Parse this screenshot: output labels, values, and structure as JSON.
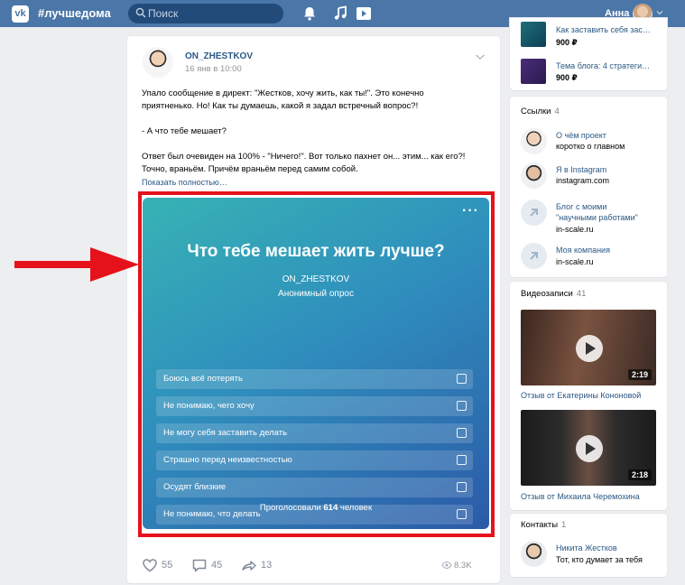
{
  "header": {
    "logo_icon": "vk-logo",
    "site_name": "#лучшедома",
    "search_placeholder": "Поиск",
    "icons": [
      "bell-icon",
      "music-icon",
      "play-icon"
    ],
    "user_name": "Анна"
  },
  "post": {
    "author": "ON_ZHESTKOV",
    "date": "16 янв в 10:00",
    "text_lines": [
      "Упало сообщение в директ: \"Жестков, хочу жить, как ты!\". Это конечно",
      "приятненько. Но! Как ты думаешь, какой я задал встречный вопрос?!",
      "- А что тебе мешает?",
      "Ответ был очевиден на 100% - \"Ничего!\". Вот только пахнет он... этим... как его?!",
      "Точно, враньём. Причём враньём перед самим собой."
    ],
    "show_more": "Показать полностью…",
    "poll": {
      "title": "Что тебе мешает жить лучше?",
      "author": "ON_ZHESTKOV",
      "type": "Анонимный опрос",
      "options": [
        "Боюсь всё потерять",
        "Не понимаю, чего хочу",
        "Не могу себя заставить делать",
        "Страшно перед неизвестностью",
        "Осудят близкие",
        "Не понимаю, что делать"
      ],
      "votes_prefix": "Проголосовали",
      "votes_count": "614",
      "votes_suffix": "человек"
    },
    "likes": "55",
    "comments": "45",
    "shares": "13",
    "views": "8.3K"
  },
  "sidebar": {
    "products": [
      {
        "title": "Как заставить себя зас…",
        "price": "900 ₽"
      },
      {
        "title": "Тема блога: 4 стратеги…",
        "price": "900 ₽"
      }
    ],
    "links": {
      "heading": "Ссылки",
      "count": "4",
      "items": [
        {
          "title": "О чём проект",
          "sub": "коротко о главном"
        },
        {
          "title": "Я в Instagram",
          "sub": "instagram.com"
        },
        {
          "title_lines": [
            "Блог с моими",
            "\"научными работами\""
          ],
          "sub": "in-scale.ru"
        },
        {
          "title": "Моя компания",
          "sub": "in-scale.ru"
        }
      ]
    },
    "videos": {
      "heading": "Видеозаписи",
      "count": "41",
      "items": [
        {
          "duration": "2:19",
          "caption": "Отзыв от Екатерины Кононовой"
        },
        {
          "duration": "2:18",
          "caption": "Отзыв от Михаила Черемохина"
        }
      ]
    },
    "contacts": {
      "heading": "Контакты",
      "count": "1",
      "items": [
        {
          "name": "Никита Жестков",
          "sub": "Тот, кто думает за тебя"
        }
      ]
    }
  },
  "colors": {
    "header": "#4a76a8",
    "link": "#2a5885",
    "highlight": "#e5121b",
    "poll_gradient_start": "#37b3b4",
    "poll_gradient_end": "#2c5aa8"
  }
}
